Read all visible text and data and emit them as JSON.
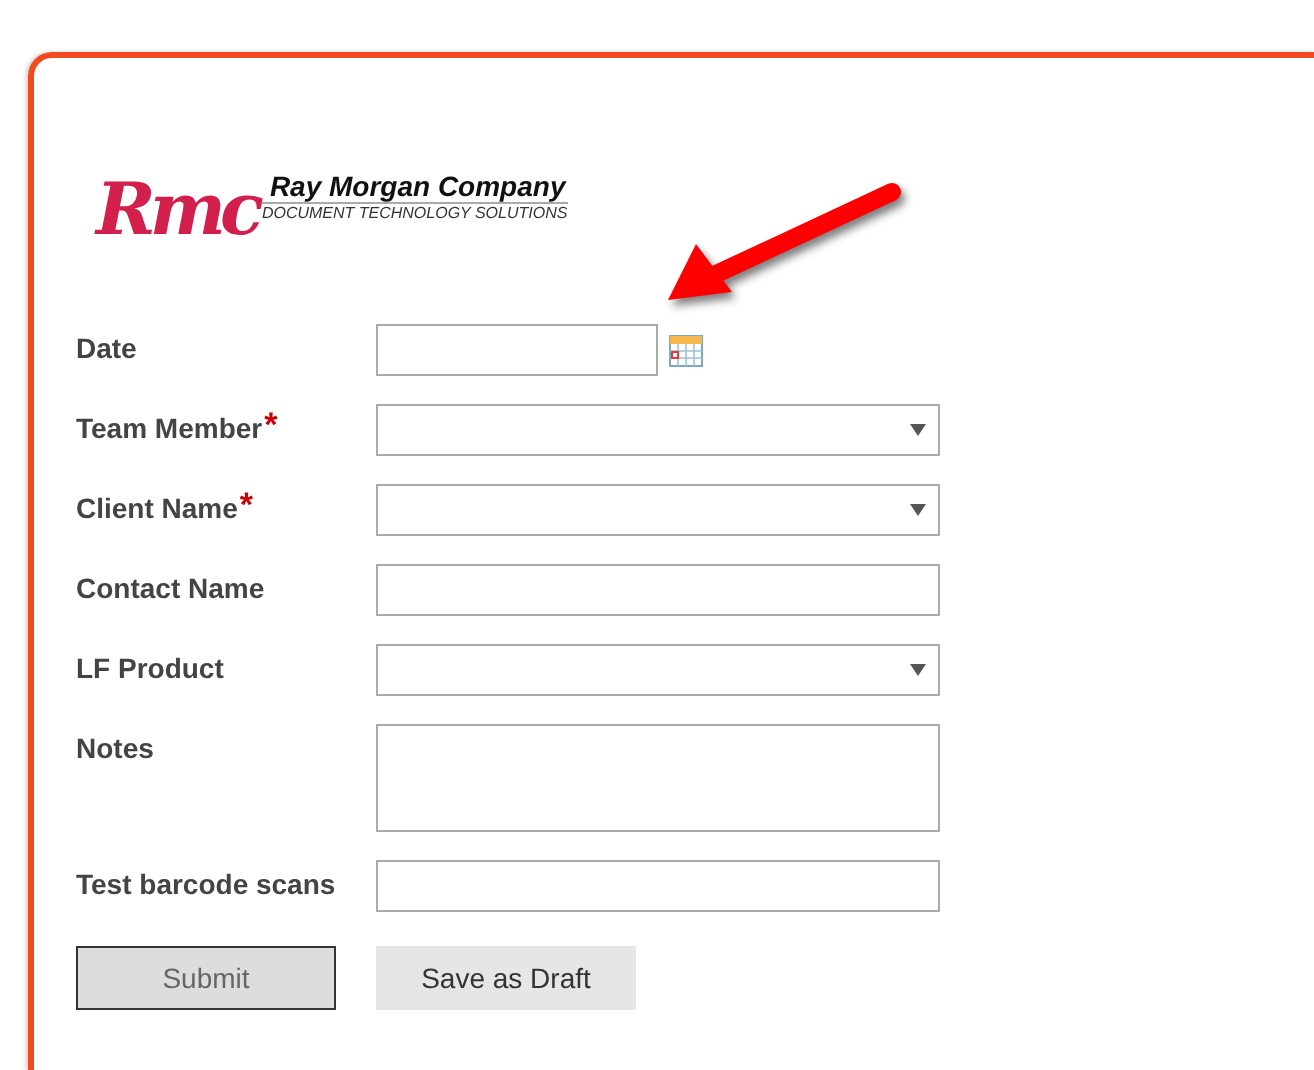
{
  "logo": {
    "mark": "Rmc",
    "company": "Ray Morgan Company",
    "tagline": "DOCUMENT TECHNOLOGY SOLUTIONS"
  },
  "fields": [
    {
      "label": "Date",
      "kind": "date"
    },
    {
      "label": "Team Member",
      "kind": "select",
      "marker": "*"
    },
    {
      "label": "Client Name",
      "kind": "select",
      "marker": "*"
    },
    {
      "label": "Contact Name",
      "kind": "text"
    },
    {
      "label": "LF Product",
      "kind": "select"
    },
    {
      "label": "Notes",
      "kind": "textarea"
    },
    {
      "label": "Test barcode scans",
      "kind": "text"
    }
  ],
  "buttons": [
    {
      "label": "Submit",
      "kind": "primary"
    },
    {
      "label": "Save as Draft",
      "kind": "secondary"
    }
  ]
}
